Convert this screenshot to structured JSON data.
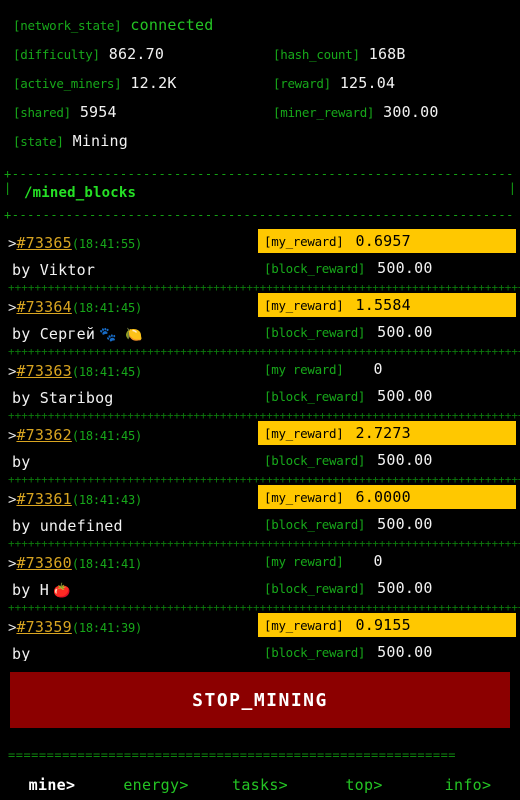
{
  "stats": {
    "rows": [
      [
        {
          "key": "[network_state]",
          "value": "connected",
          "green_value": true
        },
        null
      ],
      [
        {
          "key": "[difficulty]",
          "value": "862.70",
          "green_value": false
        },
        {
          "key": "[hash_count]",
          "value": "168B",
          "green_value": false
        }
      ],
      [
        {
          "key": "[active_miners]",
          "value": "12.2K",
          "green_value": false
        },
        {
          "key": "[reward]",
          "value": "125.04",
          "green_value": false
        }
      ],
      [
        {
          "key": "[shared]",
          "value": "5954",
          "green_value": false
        },
        {
          "key": "[miner_reward]",
          "value": "300.00",
          "green_value": false
        }
      ],
      [
        {
          "key": "[state]",
          "value": "Mining",
          "green_value": false
        },
        null
      ]
    ]
  },
  "panel": {
    "title": "/mined_blocks",
    "edge_top": "+--------------------------------------------------------------------------------------------------+",
    "edge_bottom": "+--------------------------------------------------------------------------------------------------+",
    "side_left": "|",
    "side_right": "|"
  },
  "blocks": {
    "separator": "++++++++++++++++++++++++++++++++++++++++++++++++++++++++++++++++++++++++++++++",
    "caret": ">",
    "by_prefix": "by ",
    "block_reward_key": "[block_reward]",
    "my_reward_key_highlight": "[my_reward]",
    "my_reward_key_plain": "[my reward]",
    "items": [
      {
        "id": "#73365",
        "time": "(18:41:55)",
        "miner": "Viktor",
        "emoji": "",
        "my_reward": "0.6957",
        "highlighted": true,
        "block_reward": "500.00"
      },
      {
        "id": "#73364",
        "time": "(18:41:45)",
        "miner": "Сергей",
        "emoji": "🐾 🍋",
        "my_reward": "1.5584",
        "highlighted": true,
        "block_reward": "500.00"
      },
      {
        "id": "#73363",
        "time": "(18:41:45)",
        "miner": "Staribog",
        "emoji": "",
        "my_reward": "0",
        "highlighted": false,
        "block_reward": "500.00"
      },
      {
        "id": "#73362",
        "time": "(18:41:45)",
        "miner": "",
        "emoji": "",
        "my_reward": "2.7273",
        "highlighted": true,
        "block_reward": "500.00"
      },
      {
        "id": "#73361",
        "time": "(18:41:43)",
        "miner": "undefined",
        "emoji": "",
        "my_reward": "6.0000",
        "highlighted": true,
        "block_reward": "500.00"
      },
      {
        "id": "#73360",
        "time": "(18:41:41)",
        "miner": "H",
        "emoji": "🍅",
        "my_reward": "0",
        "highlighted": false,
        "block_reward": "500.00"
      },
      {
        "id": "#73359",
        "time": "(18:41:39)",
        "miner": "",
        "emoji": "",
        "my_reward": "0.9155",
        "highlighted": true,
        "block_reward": "500.00"
      }
    ]
  },
  "stop_button": {
    "label": "STOP_MINING"
  },
  "nav": {
    "separator": "==========================================================",
    "items": [
      {
        "label": "mine>",
        "active": true
      },
      {
        "label": "energy>",
        "active": false
      },
      {
        "label": "tasks>",
        "active": false
      },
      {
        "label": "top>",
        "active": false
      },
      {
        "label": "info>",
        "active": false
      }
    ]
  },
  "colors": {
    "background": "#000000",
    "green": "#17a81a",
    "bright_green": "#24c424",
    "gold": "#d9a521",
    "highlight_yellow": "#ffc800",
    "danger_red": "#8c0000",
    "white": "#f2f2f2"
  }
}
